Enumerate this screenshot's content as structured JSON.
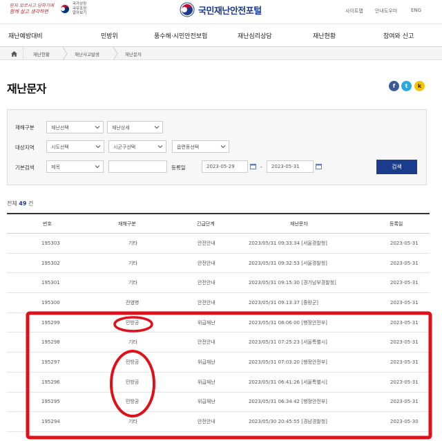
{
  "header": {
    "slogan_line1": "믿지 모르시고 당하기에",
    "slogan_line2": "함께 살고 생각하면",
    "gov_label": "국가상징 국무조정 알아보기",
    "site_title": "국민재난안전포털",
    "util_links": [
      "사이트맵",
      "안내도우미",
      "ENG"
    ]
  },
  "gnb": [
    "재난예방대비",
    "민방위",
    "풍수해·시민안전보험",
    "재난심리상담",
    "재난현황",
    "참여와 신고"
  ],
  "breadcrumb": [
    "재난현황",
    "재난사고발생",
    "재난문자"
  ],
  "page_title": "재난문자",
  "share": {
    "facebook": "f",
    "twitter": "t",
    "kakao": "k"
  },
  "search": {
    "disaster_type_label": "재해구분",
    "disaster_select": "재난선택",
    "disaster_detail": "재난상세",
    "region_label": "대상지역",
    "sido": "시도선택",
    "sigungu": "시군구선택",
    "eupmyeondong": "읍면동선택",
    "basic_label": "기본검색",
    "basic_select": "제목",
    "keyword": "",
    "date_label": "등록일",
    "date_from": "2023-05-29",
    "date_sep": "-",
    "date_to": "2023-05-31",
    "button": "검색"
  },
  "total": {
    "prefix": "전체",
    "count": "49",
    "suffix": "건"
  },
  "table": {
    "headers": [
      "번호",
      "재해구분",
      "긴급단계",
      "재난문자",
      "등록일"
    ],
    "rows": [
      [
        "195303",
        "기타",
        "안전안내",
        "2023/05/31 09:33:34 [서울경찰청]",
        "2023-05-31"
      ],
      [
        "195302",
        "기타",
        "안전안내",
        "2023/05/31 09:32:53 [서울경찰청]",
        "2023-05-31"
      ],
      [
        "195301",
        "기타",
        "안전안내",
        "2023/05/31 09:15:30 [경기남부경찰청]",
        "2023-05-31"
      ],
      [
        "195300",
        "전염병",
        "안전안내",
        "2023/05/31 09:13:37 [중랑군]",
        "2023-05-31"
      ],
      [
        "195299",
        "민방공",
        "위급재난",
        "2023/05/31 08:06:00 [행정안전부]",
        "2023-05-31"
      ],
      [
        "195298",
        "기타",
        "안전안내",
        "2023/05/31 07:25:23 [서울특별시]",
        "2023-05-31"
      ],
      [
        "195297",
        "민방공",
        "위급재난",
        "2023/05/31 07:03:20 [행정안전부]",
        "2023-05-31"
      ],
      [
        "195296",
        "민방공",
        "위급재난",
        "2023/05/31 06:41:26 [서울특별시]",
        "2023-05-31"
      ],
      [
        "195295",
        "민방공",
        "위급재난",
        "2023/05/31 06:34:42 [행정안전부]",
        "2023-05-31"
      ],
      [
        "195294",
        "기타",
        "안전안내",
        "2023/05/30 20:45:55 [경남경찰청]",
        "2023-05-30"
      ]
    ]
  },
  "colors": {
    "accent": "#1b3b8c",
    "annotation": "#e0101a",
    "facebook": "#3b5998",
    "twitter": "#29a9e1",
    "kakao": "#f2c500"
  },
  "icons": [
    "home-icon",
    "chevron-down-icon",
    "calendar-icon",
    "facebook-icon",
    "twitter-icon",
    "kakao-icon",
    "taegukgi-icon",
    "portal-logo-icon"
  ]
}
